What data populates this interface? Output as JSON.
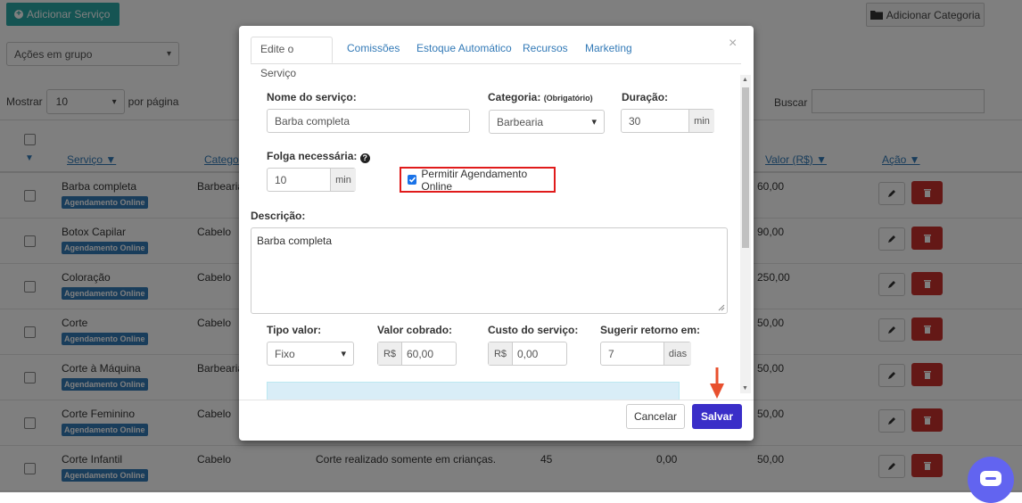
{
  "header": {
    "add_service_label": "Adicionar Serviço",
    "add_category_label": "Adicionar Categoria",
    "bulk_actions_value": "Ações em grupo"
  },
  "table_controls": {
    "show_label": "Mostrar",
    "page_size_value": "10",
    "per_page_label": "por página",
    "search_label": "Buscar"
  },
  "table": {
    "headers": {
      "service": "Serviço ▼",
      "category": "Categoria",
      "value": "Valor (R$) ▼",
      "action": "Ação ▼"
    },
    "online_badge": "Agendamento Online",
    "rows": [
      {
        "name": "Barba completa",
        "category": "Barbearia",
        "value": "60,00"
      },
      {
        "name": "Botox Capilar",
        "category": "Cabelo",
        "value": "90,00"
      },
      {
        "name": "Coloração",
        "category": "Cabelo",
        "value": "250,00"
      },
      {
        "name": "Corte",
        "category": "Cabelo",
        "value": "50,00"
      },
      {
        "name": "Corte à Máquina",
        "category": "Barbearia",
        "value": "50,00"
      },
      {
        "name": "Corte Feminino",
        "category": "Cabelo",
        "value": "50,00"
      },
      {
        "name": "Corte Infantil",
        "category": "Cabelo",
        "description": "Corte realizado somente em crianças.",
        "duration": "45",
        "cost": "0,00",
        "value": "50,00"
      }
    ]
  },
  "modal": {
    "tabs": [
      "Edite o Serviço",
      "Comissões",
      "Estoque Automático",
      "Recursos",
      "Marketing"
    ],
    "close_symbol": "×",
    "service_name_label": "Nome do serviço:",
    "service_name_value": "Barba completa",
    "category_label": "Categoria:",
    "category_required": "(Obrigatório)",
    "category_value": "Barbearia",
    "duration_label": "Duração:",
    "duration_value": "30",
    "duration_unit": "min",
    "gap_label": "Folga necessária:",
    "gap_value": "10",
    "gap_unit": "min",
    "online_booking_label": "Permitir Agendamento Online",
    "online_booking_checked": true,
    "description_label": "Descrição:",
    "description_value": "Barba completa",
    "price_type_label": "Tipo valor:",
    "price_type_value": "Fixo",
    "charged_value_label": "Valor cobrado:",
    "charged_currency": "R$",
    "charged_value": "60,00",
    "cost_label": "Custo do serviço:",
    "cost_currency": "R$",
    "cost_value": "0,00",
    "return_label": "Sugerir retorno em:",
    "return_value": "7",
    "return_unit": "dias",
    "cancel_label": "Cancelar",
    "save_label": "Salvar"
  },
  "colors": {
    "teal_button": "#2aa9a6",
    "link_blue": "#337ab7",
    "save_button": "#3a2ec8",
    "delete_red": "#c9302c",
    "highlight_red": "#e01b1b",
    "annotation_arrow": "#e8502e"
  }
}
